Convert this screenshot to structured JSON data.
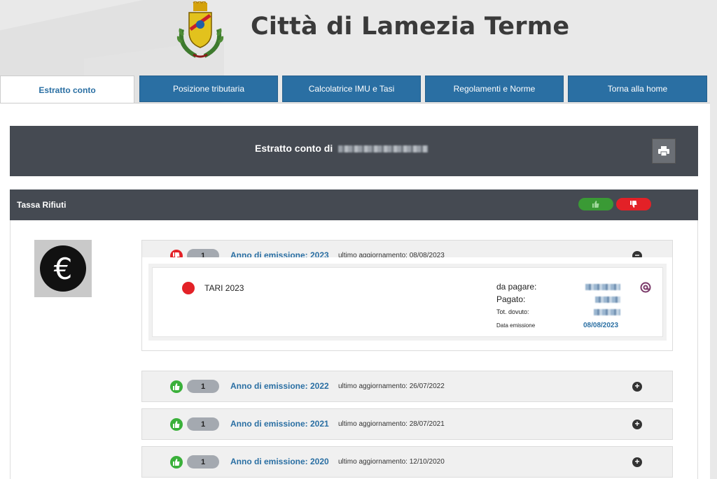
{
  "header": {
    "title": "Città di Lamezia Terme",
    "crest_icon": "coat-of-arms-icon"
  },
  "tabs": [
    {
      "label": "Estratto conto",
      "active": true
    },
    {
      "label": "Posizione tributaria",
      "active": false
    },
    {
      "label": "Calcolatrice IMU e Tasi",
      "active": false
    },
    {
      "label": "Regolamenti e Norme",
      "active": false
    },
    {
      "label": "Torna alla home",
      "active": false
    }
  ],
  "account": {
    "title_prefix": "Estratto conto di",
    "print_icon": "printer-icon"
  },
  "section": {
    "title": "Tassa Rifiuti",
    "good_icon": "thumbs-up-icon",
    "bad_icon": "thumbs-down-icon"
  },
  "years": [
    {
      "status": "ko",
      "count": "1",
      "label": "Anno di emissione: 2023",
      "updated": "ultimo aggiornamento: 08/08/2023",
      "expanded": true
    },
    {
      "status": "ok",
      "count": "1",
      "label": "Anno di emissione: 2022",
      "updated": "ultimo aggiornamento: 26/07/2022",
      "expanded": false
    },
    {
      "status": "ok",
      "count": "1",
      "label": "Anno di emissione: 2021",
      "updated": "ultimo aggiornamento: 28/07/2021",
      "expanded": false
    },
    {
      "status": "ok",
      "count": "1",
      "label": "Anno di emissione: 2020",
      "updated": "ultimo aggiornamento: 12/10/2020",
      "expanded": false
    }
  ],
  "detail": {
    "name": "TARI 2023",
    "da_pagare_label": "da pagare:",
    "pagato_label": "Pagato:",
    "tot_dovuto_label": "Tot. dovuto:",
    "data_emissione_label": "Data emissione",
    "data_emissione_value": "08/08/2023"
  },
  "colors": {
    "accent": "#2a6fa3",
    "dark_bar": "#454a52",
    "ok": "#3ab03a",
    "ko": "#e32127"
  }
}
